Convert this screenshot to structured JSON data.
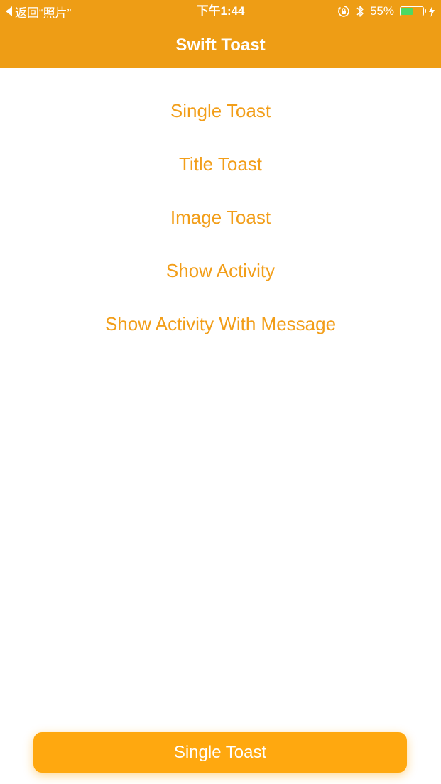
{
  "status_bar": {
    "back_label": "返回“照片”",
    "time": "下午1:44",
    "battery_percent_label": "55%",
    "battery_level": 0.55,
    "icons": [
      "orientation-lock-icon",
      "bluetooth-icon",
      "battery-icon",
      "charging-bolt-icon"
    ]
  },
  "nav": {
    "title": "Swift Toast"
  },
  "menu": {
    "items": [
      {
        "label": "Single Toast"
      },
      {
        "label": "Title Toast"
      },
      {
        "label": "Image Toast"
      },
      {
        "label": "Show Activity"
      },
      {
        "label": "Show Activity With Message"
      }
    ]
  },
  "toast": {
    "message": "Single Toast"
  },
  "colors": {
    "header": "#ee9d15",
    "accent_text": "#f29e19",
    "toast_background": "#ffa80f",
    "battery_fill": "#4cd964"
  }
}
